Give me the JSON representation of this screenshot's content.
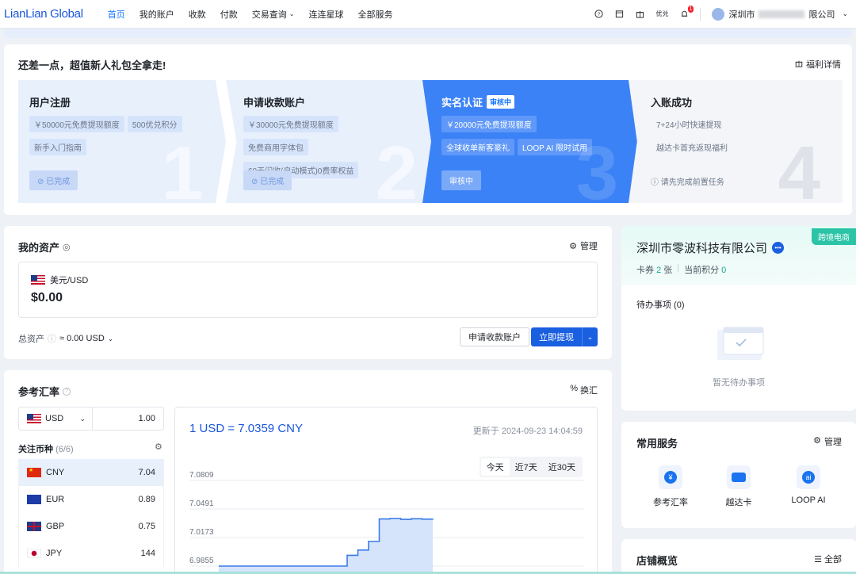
{
  "brand": {
    "logo_text": "LianLian Global"
  },
  "nav": {
    "items": [
      {
        "label": "首页",
        "active": true
      },
      {
        "label": "我的账户",
        "active": false
      },
      {
        "label": "收款",
        "active": false
      },
      {
        "label": "付款",
        "active": false
      },
      {
        "label": "交易查询",
        "active": false,
        "has_dropdown": true
      },
      {
        "label": "连连星球",
        "active": false
      },
      {
        "label": "全部服务",
        "active": false
      }
    ],
    "right": {
      "coupon_label": "优兑",
      "notification_count": "1",
      "company_prefix": "深圳市",
      "company_suffix": "限公司"
    }
  },
  "promo": {
    "title": "还差一点，超值新人礼包全拿走!",
    "welfare_link": "福利详情",
    "steps": [
      {
        "title": "用户注册",
        "tags": [
          "￥50000元免费提现额度",
          "500优兑积分",
          "新手入门指南"
        ],
        "button": "已完成",
        "number": "1"
      },
      {
        "title": "申请收款账户",
        "tags": [
          "￥30000元免费提现额度",
          "免费商用字体包",
          "60天闪收(自动模式)0费率权益"
        ],
        "button": "已完成",
        "number": "2"
      },
      {
        "title": "实名认证",
        "status": "审核中",
        "tags": [
          "￥20000元免费提现额度",
          "全球收单新客豪礼",
          "LOOP AI 限时试用"
        ],
        "button": "审核中",
        "number": "3"
      },
      {
        "title": "入账成功",
        "tags": [
          "7+24小时快速提现",
          "越达卡首充返现福利"
        ],
        "hint": "请先完成前置任务",
        "number": "4"
      }
    ]
  },
  "assets": {
    "title": "我的资产",
    "manage_label": "管理",
    "account": {
      "currency": "美元/USD",
      "amount": "$0.00"
    },
    "total_label": "总资产",
    "total_value": "≈ 0.00 USD",
    "apply_button": "申请收款账户",
    "withdraw_button": "立即提现"
  },
  "rates": {
    "title": "参考汇率",
    "exchange_label": "换汇",
    "base": {
      "currency": "USD",
      "amount": "1.00"
    },
    "watch_title": "关注币种",
    "watch_count": "(6/6)",
    "list": [
      {
        "code": "CNY",
        "rate": "7.04",
        "flag": "cn"
      },
      {
        "code": "EUR",
        "rate": "0.89",
        "flag": "eu"
      },
      {
        "code": "GBP",
        "rate": "0.75",
        "flag": "gb"
      },
      {
        "code": "JPY",
        "rate": "144",
        "flag": "jp"
      }
    ],
    "headline": "1 USD = 7.0359 CNY",
    "updated": "更新于 2024-09-23 14:04:59",
    "range_tabs": [
      "今天",
      "近7天",
      "近30天"
    ],
    "selected_range": "今天"
  },
  "chart_data": {
    "type": "area",
    "title": "",
    "xlabel": "",
    "ylabel": "",
    "y_ticks": [
      7.0809,
      7.0491,
      7.0173,
      6.9855
    ],
    "ylim": [
      6.9855,
      7.0809
    ],
    "grid": true,
    "legend": "none",
    "x": [
      0,
      1,
      2,
      3,
      4,
      5,
      6,
      7,
      8,
      9,
      10,
      11,
      12,
      13,
      14,
      15,
      16,
      17,
      18,
      19,
      20
    ],
    "values": [
      6.9855,
      6.9855,
      6.9855,
      6.9855,
      6.9855,
      6.9855,
      6.9855,
      6.9855,
      6.9855,
      6.9855,
      6.9855,
      6.9855,
      6.9975,
      7.0033,
      7.013,
      7.038,
      7.0386,
      7.0376,
      7.0382,
      7.0378,
      7.0384
    ],
    "color": "#3b7be8"
  },
  "company": {
    "badge": "跨境电商",
    "name": "深圳市零波科技有限公司",
    "coupon_label": "卡券",
    "coupon_count": "2",
    "coupon_unit": "张",
    "points_label": "当前积分",
    "points_value": "0",
    "todo_title": "待办事项 (0)",
    "todo_empty": "暂无待办事项"
  },
  "services": {
    "title": "常用服务",
    "manage_label": "管理",
    "items": [
      {
        "label": "参考汇率",
        "icon": "exchange-rate-icon"
      },
      {
        "label": "越达卡",
        "icon": "card-icon"
      },
      {
        "label": "LOOP AI",
        "icon": "loop-ai-icon"
      }
    ]
  },
  "shop": {
    "title": "店铺概览",
    "all_label": "全部"
  }
}
